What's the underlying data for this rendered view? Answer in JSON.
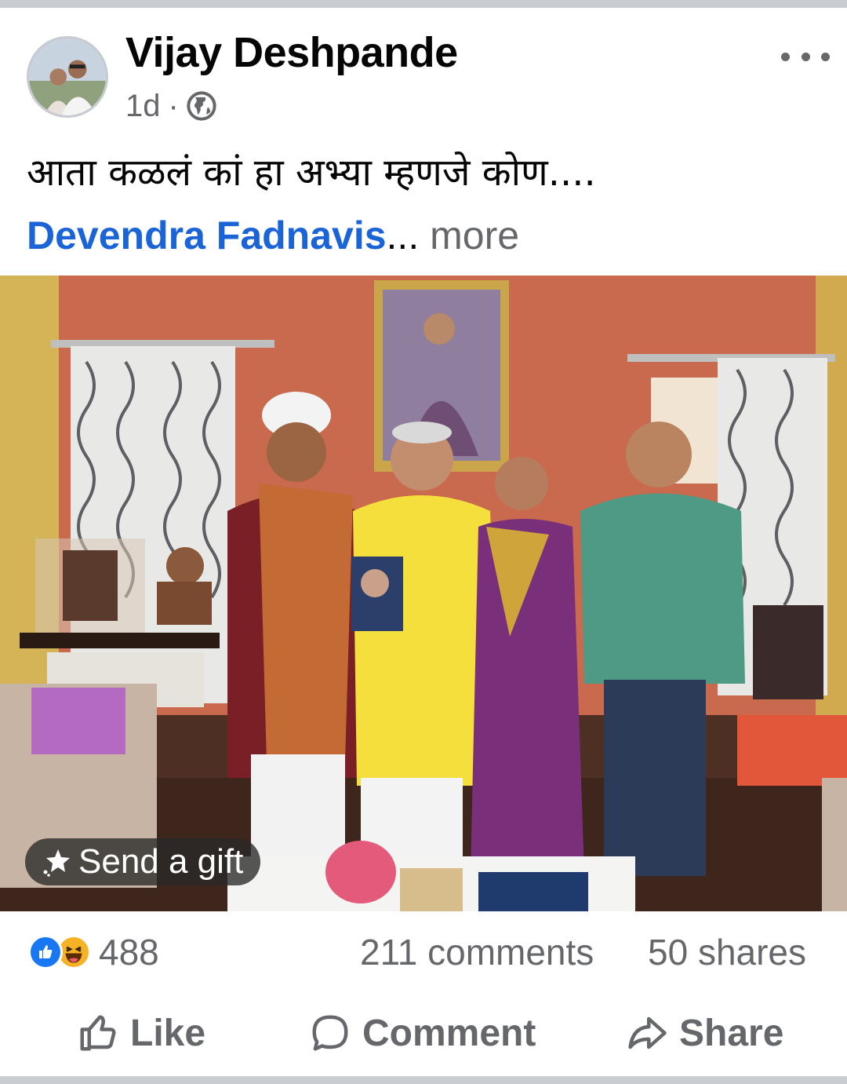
{
  "post": {
    "author": "Vijay Deshpande",
    "time": "1d",
    "separator": "·",
    "privacy_icon": "globe-icon",
    "text_line": "आता कळलं कां हा अभ्या म्हणजे कोण....",
    "mention": "Devendra Fadnavis",
    "ellipsis": "...",
    "see_more": " more",
    "photo_overlay": {
      "gift_label": "Send a gift",
      "gift_icon": "gift-sparkle-icon"
    }
  },
  "stats": {
    "reaction_icons": [
      "like-reaction-icon",
      "haha-reaction-icon"
    ],
    "reaction_count": "488",
    "comments": "211 comments",
    "shares": "50 shares"
  },
  "actions": {
    "like": "Like",
    "comment": "Comment",
    "share": "Share"
  },
  "colors": {
    "mention": "#1b64d8",
    "secondary_text": "#65676b",
    "like_blue": "#1877f2",
    "haha_yellow": "#f7b125",
    "separator": "#c9ccd1"
  }
}
